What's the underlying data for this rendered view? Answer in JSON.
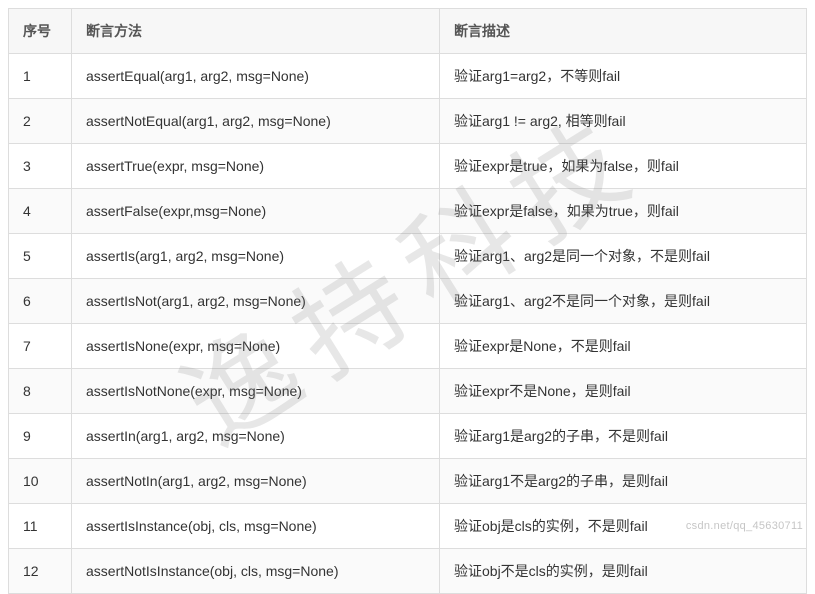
{
  "headers": {
    "col1": "序号",
    "col2": "断言方法",
    "col3": "断言描述"
  },
  "rows": [
    {
      "n": "1",
      "method": "assertEqual(arg1, arg2, msg=None)",
      "desc": "验证arg1=arg2，不等则fail"
    },
    {
      "n": "2",
      "method": "assertNotEqual(arg1, arg2, msg=None)",
      "desc": "验证arg1 != arg2, 相等则fail"
    },
    {
      "n": "3",
      "method": "assertTrue(expr, msg=None)",
      "desc": "验证expr是true，如果为false，则fail"
    },
    {
      "n": "4",
      "method": "assertFalse(expr,msg=None)",
      "desc": "验证expr是false，如果为true，则fail"
    },
    {
      "n": "5",
      "method": "assertIs(arg1, arg2, msg=None)",
      "desc": "验证arg1、arg2是同一个对象，不是则fail"
    },
    {
      "n": "6",
      "method": "assertIsNot(arg1, arg2, msg=None)",
      "desc": "验证arg1、arg2不是同一个对象，是则fail"
    },
    {
      "n": "7",
      "method": "assertIsNone(expr, msg=None)",
      "desc": "验证expr是None，不是则fail"
    },
    {
      "n": "8",
      "method": "assertIsNotNone(expr, msg=None)",
      "desc": "验证expr不是None，是则fail"
    },
    {
      "n": "9",
      "method": "assertIn(arg1, arg2, msg=None)",
      "desc": "验证arg1是arg2的子串，不是则fail"
    },
    {
      "n": "10",
      "method": "assertNotIn(arg1, arg2, msg=None)",
      "desc": "验证arg1不是arg2的子串，是则fail"
    },
    {
      "n": "11",
      "method": "assertIsInstance(obj, cls, msg=None)",
      "desc": "验证obj是cls的实例，不是则fail"
    },
    {
      "n": "12",
      "method": "assertNotIsInstance(obj, cls, msg=None)",
      "desc": "验证obj不是cls的实例，是则fail"
    }
  ],
  "watermark": "逸持科技",
  "small_watermark": "csdn.net/qq_45630711"
}
